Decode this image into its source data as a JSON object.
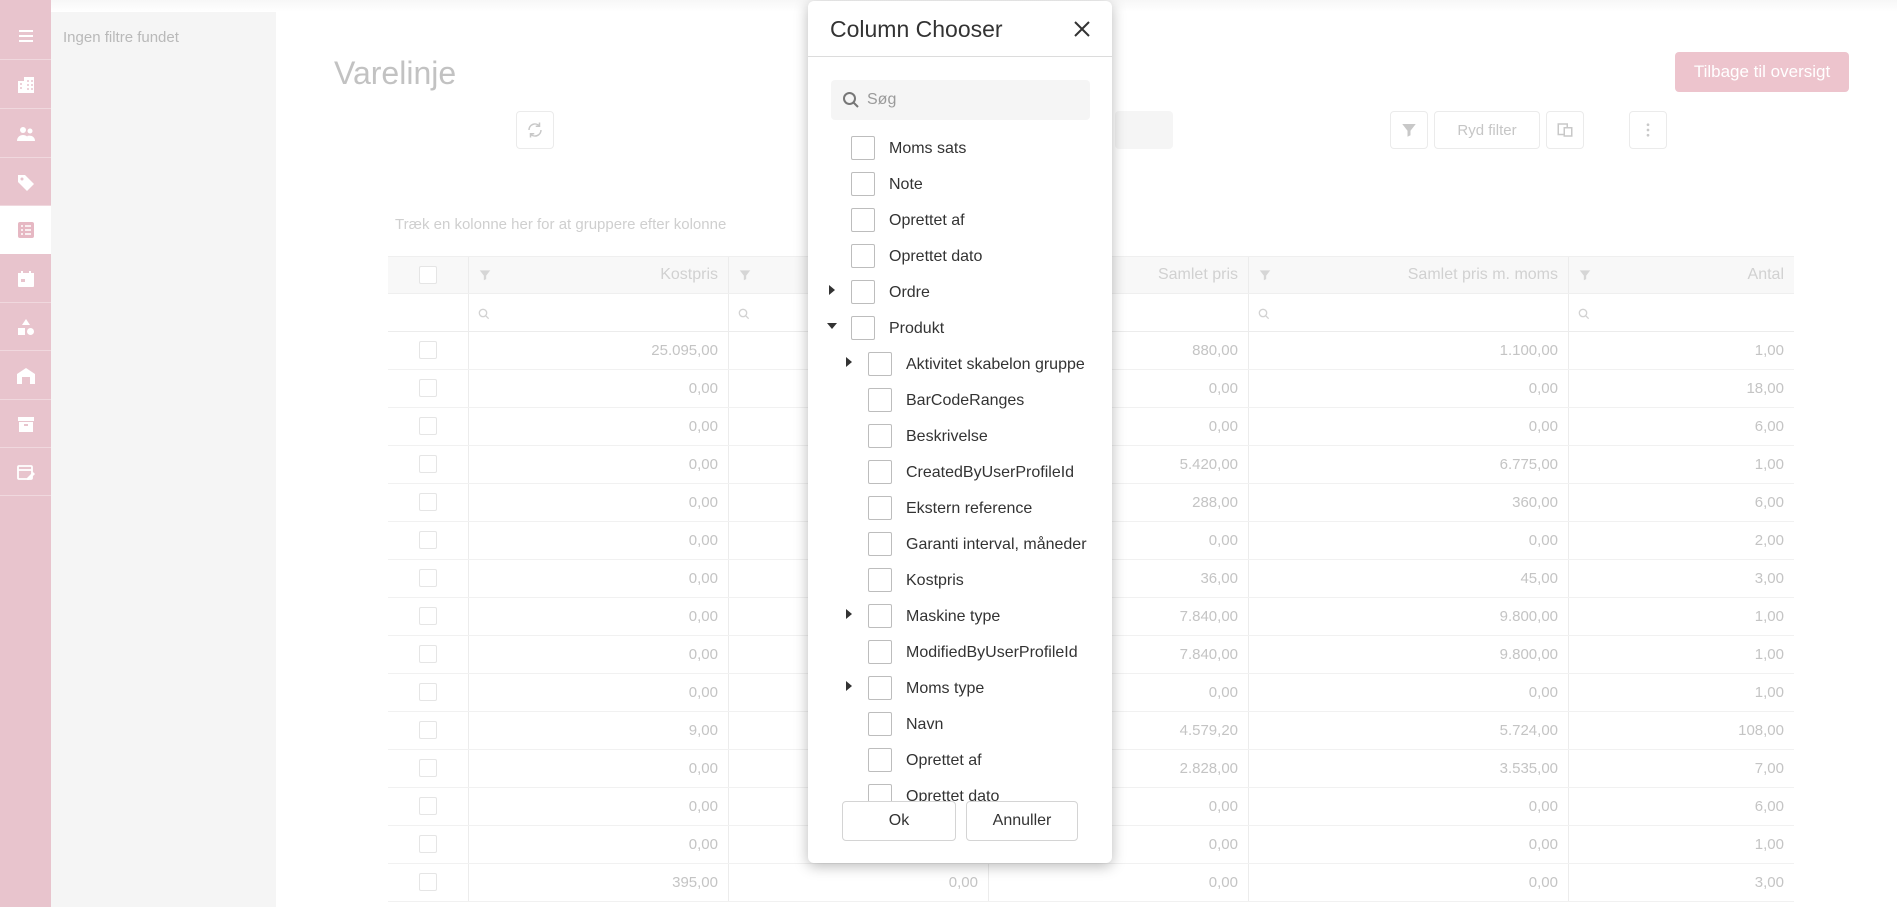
{
  "sidebar": {
    "icons": [
      {
        "name": "menu-icon"
      },
      {
        "name": "building-icon"
      },
      {
        "name": "users-icon"
      },
      {
        "name": "tag-icon"
      },
      {
        "name": "list-icon",
        "active": true
      },
      {
        "name": "calendar-icon"
      },
      {
        "name": "shapes-icon"
      },
      {
        "name": "warehouse-icon"
      },
      {
        "name": "archive-icon"
      },
      {
        "name": "calendar-edit-icon"
      }
    ],
    "filter_text": "Ingen filtre fundet"
  },
  "page": {
    "title": "Varelinje",
    "back_button": "Tilbage til oversigt",
    "clear_filter": "Ryd filter",
    "group_hint": "Træk en kolonne her for at gruppere efter kolonne"
  },
  "grid": {
    "columns": [
      "Kostpris",
      "",
      "Samlet pris",
      "Samlet pris m. moms",
      "Antal"
    ],
    "rows": [
      [
        "25.095,00",
        "",
        "880,00",
        "1.100,00",
        "1,00"
      ],
      [
        "0,00",
        "",
        "0,00",
        "0,00",
        "18,00"
      ],
      [
        "0,00",
        "",
        "0,00",
        "0,00",
        "6,00"
      ],
      [
        "0,00",
        "",
        "5.420,00",
        "6.775,00",
        "1,00"
      ],
      [
        "0,00",
        "",
        "288,00",
        "360,00",
        "6,00"
      ],
      [
        "0,00",
        "",
        "0,00",
        "0,00",
        "2,00"
      ],
      [
        "0,00",
        "",
        "36,00",
        "45,00",
        "3,00"
      ],
      [
        "0,00",
        "",
        "7.840,00",
        "9.800,00",
        "1,00"
      ],
      [
        "0,00",
        "",
        "7.840,00",
        "9.800,00",
        "1,00"
      ],
      [
        "0,00",
        "",
        "0,00",
        "0,00",
        "1,00"
      ],
      [
        "9,00",
        "",
        "4.579,20",
        "5.724,00",
        "108,00"
      ],
      [
        "0,00",
        "",
        "2.828,00",
        "3.535,00",
        "7,00"
      ],
      [
        "0,00",
        "",
        "0,00",
        "0,00",
        "6,00"
      ],
      [
        "0,00",
        "",
        "0,00",
        "0,00",
        "1,00"
      ],
      [
        "395,00",
        "0,00",
        "0,00",
        "0,00",
        "3,00"
      ]
    ]
  },
  "dialog": {
    "title": "Column Chooser",
    "search_placeholder": "Søg",
    "items": [
      {
        "label": "Moms sats",
        "level": 0,
        "expander": "none"
      },
      {
        "label": "Note",
        "level": 0,
        "expander": "none"
      },
      {
        "label": "Oprettet af",
        "level": 0,
        "expander": "none"
      },
      {
        "label": "Oprettet dato",
        "level": 0,
        "expander": "none"
      },
      {
        "label": "Ordre",
        "level": 0,
        "expander": "collapsed"
      },
      {
        "label": "Produkt",
        "level": 0,
        "expander": "expanded"
      },
      {
        "label": "Aktivitet skabelon gruppe",
        "level": 1,
        "expander": "collapsed"
      },
      {
        "label": "BarCodeRanges",
        "level": 1,
        "expander": "none"
      },
      {
        "label": "Beskrivelse",
        "level": 1,
        "expander": "none"
      },
      {
        "label": "CreatedByUserProfileId",
        "level": 1,
        "expander": "none"
      },
      {
        "label": "Ekstern reference",
        "level": 1,
        "expander": "none"
      },
      {
        "label": "Garanti interval, måneder",
        "level": 1,
        "expander": "none"
      },
      {
        "label": "Kostpris",
        "level": 1,
        "expander": "none"
      },
      {
        "label": "Maskine type",
        "level": 1,
        "expander": "collapsed"
      },
      {
        "label": "ModifiedByUserProfileId",
        "level": 1,
        "expander": "none"
      },
      {
        "label": "Moms type",
        "level": 1,
        "expander": "collapsed"
      },
      {
        "label": "Navn",
        "level": 1,
        "expander": "none"
      },
      {
        "label": "Oprettet af",
        "level": 1,
        "expander": "none"
      },
      {
        "label": "Oprettet dato",
        "level": 1,
        "expander": "none"
      }
    ],
    "ok_label": "Ok",
    "cancel_label": "Annuller"
  }
}
